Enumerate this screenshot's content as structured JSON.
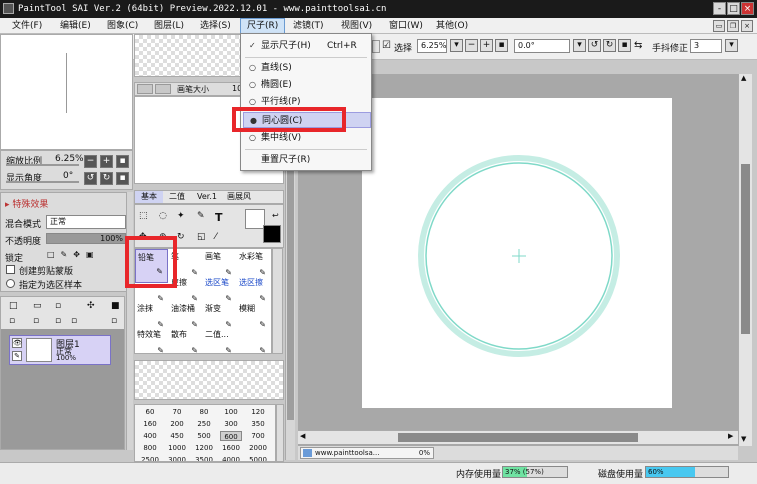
{
  "window": {
    "title": "PaintTool SAI Ver.2 (64bit) Preview.2022.12.01 - www.painttoolsai.cn",
    "controls": [
      "-",
      "□",
      "×"
    ]
  },
  "menubar": {
    "items": [
      "文件(F)",
      "编辑(E)",
      "图象(C)",
      "图层(L)",
      "选择(S)",
      "尺子(R)",
      "滤镜(T)",
      "视图(V)",
      "窗口(W)",
      "其他(O)"
    ],
    "active": "尺子(R)"
  },
  "ruler_menu": {
    "items": [
      {
        "label": "显示尺子(H)",
        "shortcut": "Ctrl+R",
        "mark": "check"
      },
      {
        "label": "直线(S)",
        "shortcut": "",
        "mark": "radio"
      },
      {
        "label": "椭圆(E)",
        "shortcut": "",
        "mark": "radio"
      },
      {
        "label": "平行线(P)",
        "shortcut": "",
        "mark": "radio"
      },
      {
        "label": "同心圆(C)",
        "shortcut": "",
        "mark": "radio-selected"
      },
      {
        "label": "集中线(V)",
        "shortcut": "",
        "mark": "radio"
      },
      {
        "label": "重置尺子(R)",
        "shortcut": "",
        "mark": ""
      }
    ]
  },
  "toolbar": {
    "selection_label": "选择",
    "zoom": "6.25%",
    "angle": "0.0°",
    "stabilizer_label": "手抖修正",
    "stabilizer_value": "3"
  },
  "navigator": {
    "zoom_label": "缩放比例",
    "zoom_value": "6.25%",
    "angle_label": "显示角度",
    "angle_value": "0°"
  },
  "layer_props": {
    "effects_label": "特殊效果",
    "blend_label": "混合模式",
    "blend_value": "正常",
    "opacity_label": "不透明度",
    "opacity_value": "100%",
    "opacity_fraction": 1.0,
    "lock_label": "锁定",
    "clip_label": "创建剪贴蒙版",
    "sample_label": "指定为选区样本"
  },
  "layers": [
    {
      "name": "图层1",
      "mode": "正常",
      "opacity": "100%"
    }
  ],
  "brush_preview": {
    "size_label": "画笔大小",
    "size_value": "10"
  },
  "tool_tabs": [
    "基本",
    "二值",
    "Ver.1",
    "画展风"
  ],
  "tools": [
    {
      "name": "铅笔",
      "sub": "",
      "selected": true
    },
    {
      "name": "笔",
      "sub": "",
      "selected": false
    },
    {
      "name": "画笔",
      "sub": "",
      "selected": false
    },
    {
      "name": "水彩笔",
      "sub": "",
      "selected": false
    },
    {
      "name": "",
      "sub": "",
      "selected": false
    },
    {
      "name": "皮擦",
      "sub": "",
      "selected": false
    },
    {
      "name": "选区笔",
      "sub": "",
      "selected": false
    },
    {
      "name": "选区擦",
      "sub": "",
      "selected": false
    },
    {
      "name": "涂抹",
      "sub": "",
      "selected": false
    },
    {
      "name": "油漆桶",
      "sub": "",
      "selected": false
    },
    {
      "name": "渐变",
      "sub": "",
      "selected": false
    },
    {
      "name": "模糊",
      "sub": "",
      "selected": false
    },
    {
      "name": "特效笔",
      "sub": "",
      "selected": false
    },
    {
      "name": "散布",
      "sub": "",
      "selected": false
    },
    {
      "name": "二值...",
      "sub": "",
      "selected": false
    },
    {
      "name": "",
      "sub": "",
      "selected": false
    }
  ],
  "brush_sizes": [
    [
      "60",
      "70",
      "80",
      "100",
      "120"
    ],
    [
      "160",
      "200",
      "250",
      "300",
      "350"
    ],
    [
      "400",
      "450",
      "500",
      "600",
      "700"
    ],
    [
      "800",
      "1000",
      "1200",
      "1600",
      "2000"
    ],
    [
      "2500",
      "3000",
      "3500",
      "4000",
      "5000"
    ]
  ],
  "brush_sizes_selected": "600",
  "status": {
    "document": "www.painttoolsa...",
    "document_percent": "0%",
    "memory_label": "内存使用量",
    "memory_value": "37% (57%)",
    "memory_fraction": 0.37,
    "disk_label": "磁盘使用量",
    "disk_value": "60%",
    "disk_fraction": 0.6
  },
  "colors": {
    "canvas_bg": "#a8a8a8",
    "circle_outer": "#c5ede4",
    "circle_inner": "#7fd9c8",
    "accent": "#3aa0ff",
    "red_highlight": "#e8262a"
  }
}
